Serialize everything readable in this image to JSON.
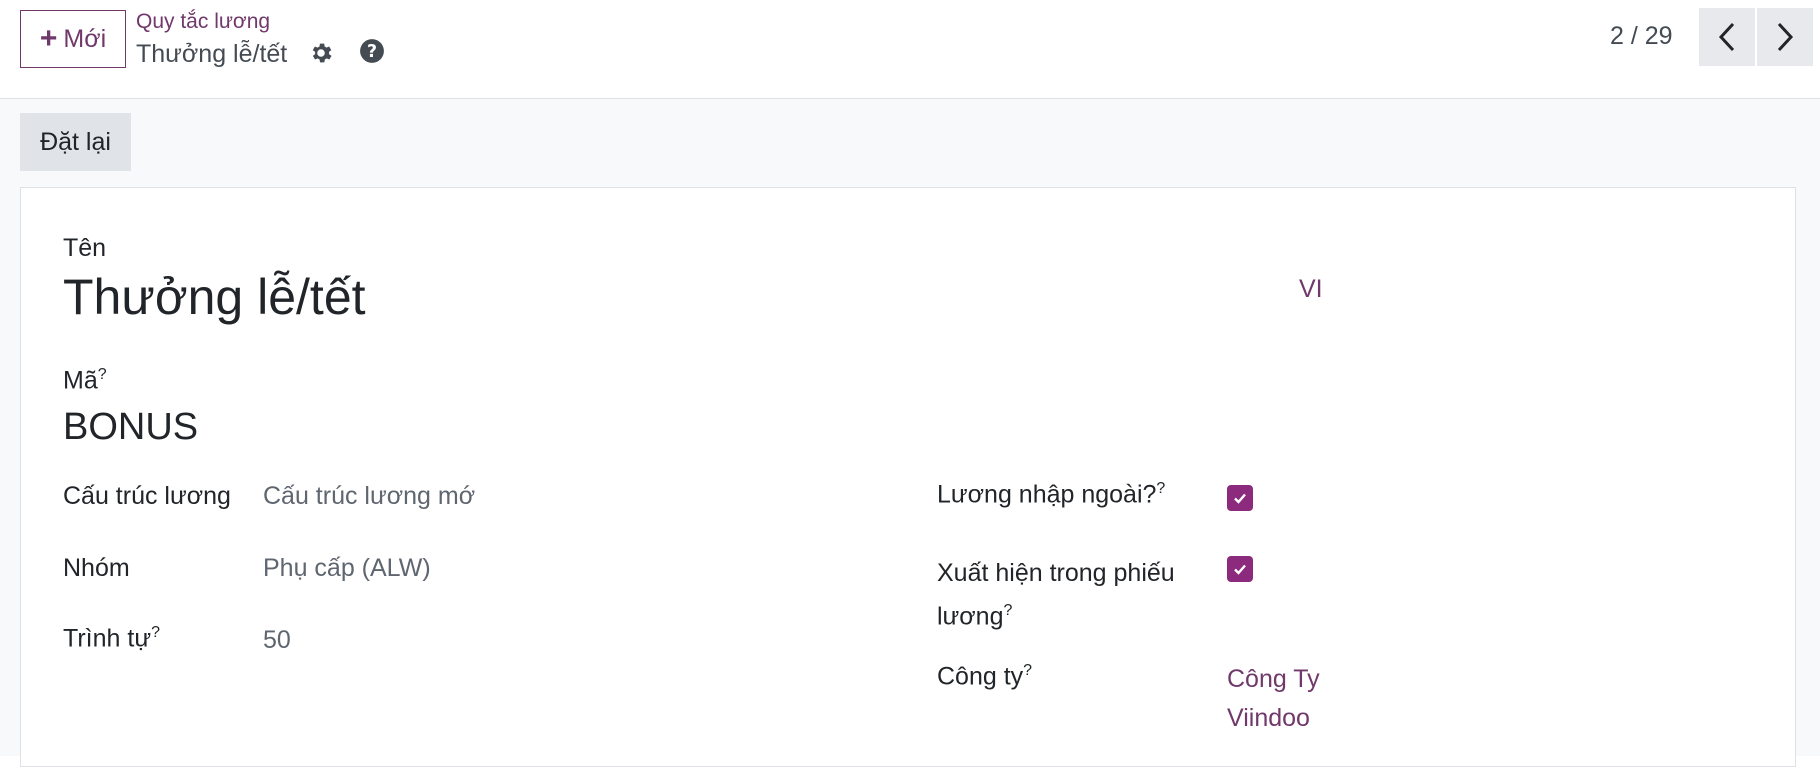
{
  "header": {
    "new_label": "Mới",
    "breadcrumb": "Quy tắc lương",
    "record_title": "Thưởng lễ/tết",
    "pager": "2 / 29"
  },
  "actions": {
    "reset_label": "Đặt lại"
  },
  "form": {
    "name_label": "Tên",
    "name_value": "Thưởng lễ/tết",
    "lang": "VI",
    "code_label": "Mã",
    "code_value": "BONUS",
    "structure_label": "Cấu trúc lương",
    "structure_value": "Cấu trúc lương mớ",
    "category_label": "Nhóm",
    "category_value": "Phụ cấp (ALW)",
    "sequence_label": "Trình tự",
    "sequence_value": "50",
    "external_label": "Lương nhập ngoài?",
    "external_checked": true,
    "appears_label_line1": "Xuất hiện trong phiếu",
    "appears_label_line2": "lương",
    "appears_checked": true,
    "company_label": "Công ty",
    "company_line1": "Công Ty",
    "company_line2": "Viindoo",
    "help_mark": "?"
  },
  "colors": {
    "brand": "#71386a",
    "checkbox": "#8c2b7e"
  }
}
